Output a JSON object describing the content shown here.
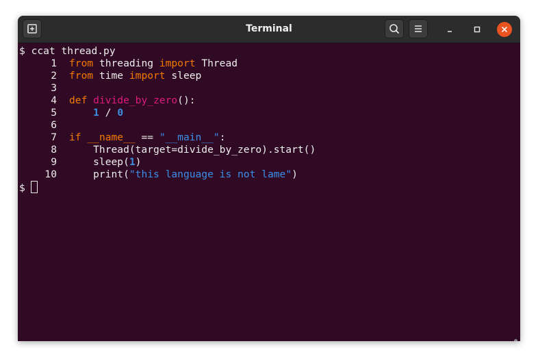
{
  "window": {
    "title": "Terminal"
  },
  "prompt": "$",
  "command": "ccat thread.py",
  "code_lines": [
    {
      "num": "1",
      "tokens": [
        {
          "t": "from",
          "c": "kw"
        },
        {
          "t": " threading ",
          "c": ""
        },
        {
          "t": "import",
          "c": "kw"
        },
        {
          "t": " Thread",
          "c": ""
        }
      ]
    },
    {
      "num": "2",
      "tokens": [
        {
          "t": "from",
          "c": "kw"
        },
        {
          "t": " time ",
          "c": ""
        },
        {
          "t": "import",
          "c": "kw"
        },
        {
          "t": " sleep",
          "c": ""
        }
      ]
    },
    {
      "num": "3",
      "tokens": []
    },
    {
      "num": "4",
      "tokens": [
        {
          "t": "def",
          "c": "kw"
        },
        {
          "t": " ",
          "c": ""
        },
        {
          "t": "divide_by_zero",
          "c": "fn"
        },
        {
          "t": "():",
          "c": ""
        }
      ]
    },
    {
      "num": "5",
      "tokens": [
        {
          "t": "    ",
          "c": ""
        },
        {
          "t": "1",
          "c": "num"
        },
        {
          "t": " / ",
          "c": ""
        },
        {
          "t": "0",
          "c": "num"
        }
      ]
    },
    {
      "num": "6",
      "tokens": []
    },
    {
      "num": "7",
      "tokens": [
        {
          "t": "if",
          "c": "kw"
        },
        {
          "t": " ",
          "c": ""
        },
        {
          "t": "__name__",
          "c": "kw"
        },
        {
          "t": " == ",
          "c": ""
        },
        {
          "t": "\"__main__\"",
          "c": "str"
        },
        {
          "t": ":",
          "c": ""
        }
      ]
    },
    {
      "num": "8",
      "tokens": [
        {
          "t": "    Thread(target=divide_by_zero).start()",
          "c": ""
        }
      ]
    },
    {
      "num": "9",
      "tokens": [
        {
          "t": "    sleep(",
          "c": ""
        },
        {
          "t": "1",
          "c": "num"
        },
        {
          "t": ")",
          "c": ""
        }
      ]
    },
    {
      "num": "10",
      "tokens": [
        {
          "t": "    print(",
          "c": ""
        },
        {
          "t": "\"this language is not lame\"",
          "c": "str"
        },
        {
          "t": ")",
          "c": ""
        }
      ]
    }
  ],
  "icons": {
    "new_tab": "new-tab-icon",
    "search": "search-icon",
    "menu": "hamburger-menu-icon",
    "minimize": "minimize-icon",
    "maximize": "maximize-icon",
    "close": "close-icon"
  },
  "colors": {
    "background": "#300a24",
    "keyword": "#f57900",
    "function": "#e0197d",
    "number": "#3d8fe0",
    "string": "#3b8eea",
    "close_button": "#e95420"
  }
}
